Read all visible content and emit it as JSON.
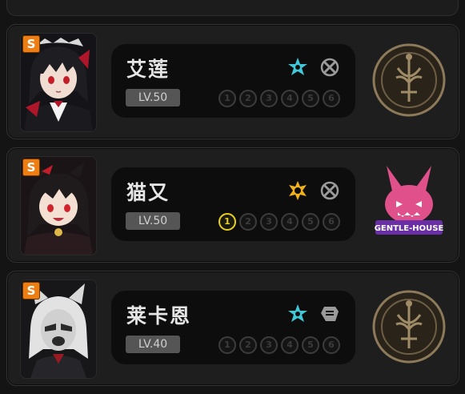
{
  "agents": [
    {
      "rank": "S",
      "name": "艾莲",
      "level": "LV.50",
      "attribute_icon": "ice-star-icon",
      "specialty_icon": "attack-crossed-icon",
      "faction_icon": "victoria-housekeeping-emblem",
      "faction_text": "VICTORIA HOUSEKEEPING",
      "skills": [
        "1",
        "2",
        "3",
        "4",
        "5",
        "6"
      ],
      "skills_unlocked": 0
    },
    {
      "rank": "S",
      "name": "猫又",
      "level": "LV.50",
      "attribute_icon": "physical-star-icon",
      "specialty_icon": "attack-crossed-icon",
      "faction_icon": "gentle-house-emblem",
      "faction_text": "GENTLE HOUSE",
      "skills": [
        "1",
        "2",
        "3",
        "4",
        "5",
        "6"
      ],
      "skills_unlocked": 1
    },
    {
      "rank": "S",
      "name": "莱卡恩",
      "level": "LV.40",
      "attribute_icon": "ice-star-icon",
      "specialty_icon": "stun-fist-icon",
      "faction_icon": "victoria-housekeeping-emblem",
      "faction_text": "VICTORIA HOUSEKEEPING",
      "skills": [
        "1",
        "2",
        "3",
        "4",
        "5",
        "6"
      ],
      "skills_unlocked": 0
    }
  ],
  "colors": {
    "rank_s": "#ee7d12",
    "ice": "#3fc8d8",
    "physical": "#f2b21a",
    "skill_active": "#e9d11a",
    "skill_locked": "#3c3c3c",
    "gentle_house": "#9c3fd1"
  }
}
